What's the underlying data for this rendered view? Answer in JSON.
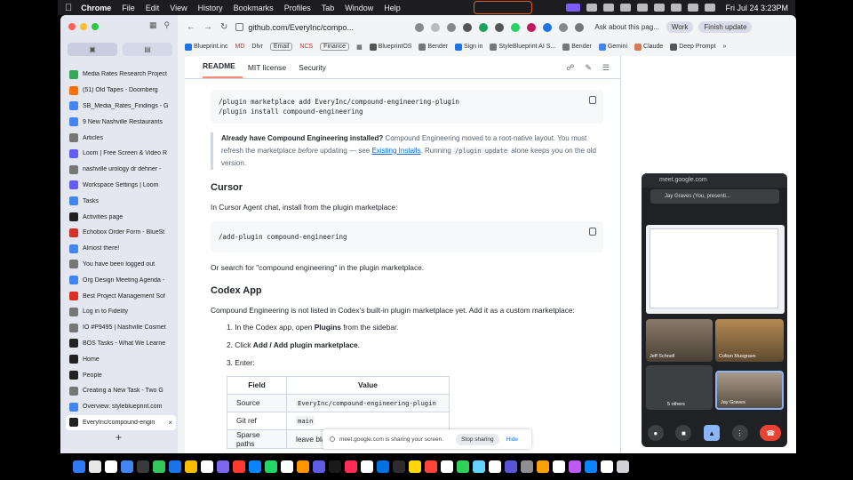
{
  "menubar": {
    "app_name": "Chrome",
    "items": [
      "File",
      "Edit",
      "View",
      "History",
      "Bookmarks",
      "Profiles",
      "Tab",
      "Window",
      "Help"
    ],
    "clock": "Fri Jul 24  3:23PM"
  },
  "browser": {
    "url": "github.com/EveryInc/compo...",
    "ask_label": "Ask about this pag...",
    "profile_label": "Work",
    "finish_update_label": "Finish update"
  },
  "bookmarks": [
    "Blueprint.inc",
    "MD",
    "Dlvr",
    "Email",
    "NCS",
    "Finance",
    "BlueprintOS",
    "Bender",
    "Sign in",
    "StyleBlueprint AI S...",
    "Bender",
    "Gemini",
    "Claude",
    "Deep Prompt"
  ],
  "sidebar": {
    "tabs": [
      {
        "label": "Media Rates Research Project",
        "color": "#34a853"
      },
      {
        "label": "(51) Old Tapes - Doomberg",
        "color": "#ff6f00"
      },
      {
        "label": "SB_Media_Rates_Findings - G",
        "color": "#4285f4"
      },
      {
        "label": "9 New Nashville Restaurants",
        "color": "#4285f4"
      },
      {
        "label": "Articles",
        "color": "#777777"
      },
      {
        "label": "Loom | Free Screen & Video R",
        "color": "#625df5"
      },
      {
        "label": "nashville urology dr dehner -",
        "color": "#777777"
      },
      {
        "label": "Workspace Settings | Loom",
        "color": "#625df5"
      },
      {
        "label": "Tasks",
        "color": "#4285f4"
      },
      {
        "label": "Activities page",
        "color": "#222222"
      },
      {
        "label": "Echobox Order Form - BlueSt",
        "color": "#d93025"
      },
      {
        "label": "Almost there!",
        "color": "#4285f4"
      },
      {
        "label": "You have been logged out",
        "color": "#777777"
      },
      {
        "label": "Org Design Meeting Agenda -",
        "color": "#4285f4"
      },
      {
        "label": "Best Project Management Sof",
        "color": "#d93025"
      },
      {
        "label": "Log in to Fidelity",
        "color": "#777777"
      },
      {
        "label": "IO #P9495 | Nashville Cosmet",
        "color": "#777777"
      },
      {
        "label": "BOS Tasks - What We Learne",
        "color": "#222222"
      },
      {
        "label": "Home",
        "color": "#222222"
      },
      {
        "label": "People",
        "color": "#222222"
      },
      {
        "label": "Creating a New Task - Two G",
        "color": "#777777"
      },
      {
        "label": "Overview: styleblueprint.com",
        "color": "#4285f4"
      },
      {
        "label": "EveryInc/compound-engin",
        "color": "#222222",
        "active": true
      }
    ],
    "new_tab_symbol": "+"
  },
  "readme": {
    "tabs": [
      "README",
      "MIT license",
      "Security"
    ],
    "code_block_1": [
      "/plugin marketplace add EveryInc/compound-engineering-plugin",
      "/plugin install compound-engineering"
    ],
    "note": {
      "bold": "Already have Compound Engineering installed?",
      "text1": " Compound Engineering moved to a root-native layout. You must refresh the marketplace ",
      "italic": "before",
      "text2": " updating — see ",
      "link": "Existing Installs",
      "text3": ". Running ",
      "code": "/plugin update",
      "text4": " alone keeps you on the old version."
    },
    "cursor_heading": "Cursor",
    "cursor_intro": "In Cursor Agent chat, install from the plugin marketplace:",
    "code_block_2": "/add-plugin compound-engineering",
    "cursor_or": "Or search for \"compound engineering\" in the plugin marketplace.",
    "codex_heading": "Codex App",
    "codex_intro": "Compound Engineering is not listed in Codex's built-in plugin marketplace yet. Add it as a custom marketplace:",
    "steps": {
      "s1_prefix": "1. In the Codex app, open ",
      "s1_bold": "Plugins",
      "s1_suffix": " from the sidebar.",
      "s2_prefix": "2. Click ",
      "s2_bold": "Add / Add plugin marketplace",
      "s2_suffix": ".",
      "s3": "3. Enter:"
    },
    "table": {
      "headers": [
        "Field",
        "Value"
      ],
      "rows": [
        [
          "Source",
          "EveryInc/compound-engineering-plugin"
        ],
        [
          "Git ref",
          "main"
        ],
        [
          "Sparse paths",
          "leave bla"
        ]
      ]
    }
  },
  "share_banner": {
    "text": "meet.google.com is sharing your screen.",
    "stop_label": "Stop sharing",
    "hide_label": "Hide"
  },
  "meet": {
    "title": "meet.google.com",
    "presenter": "Jay Graves (You, presenti...",
    "participants": [
      "Jeff Schnell",
      "Colton Musgrave",
      "5 others",
      "Jay Graves"
    ]
  }
}
